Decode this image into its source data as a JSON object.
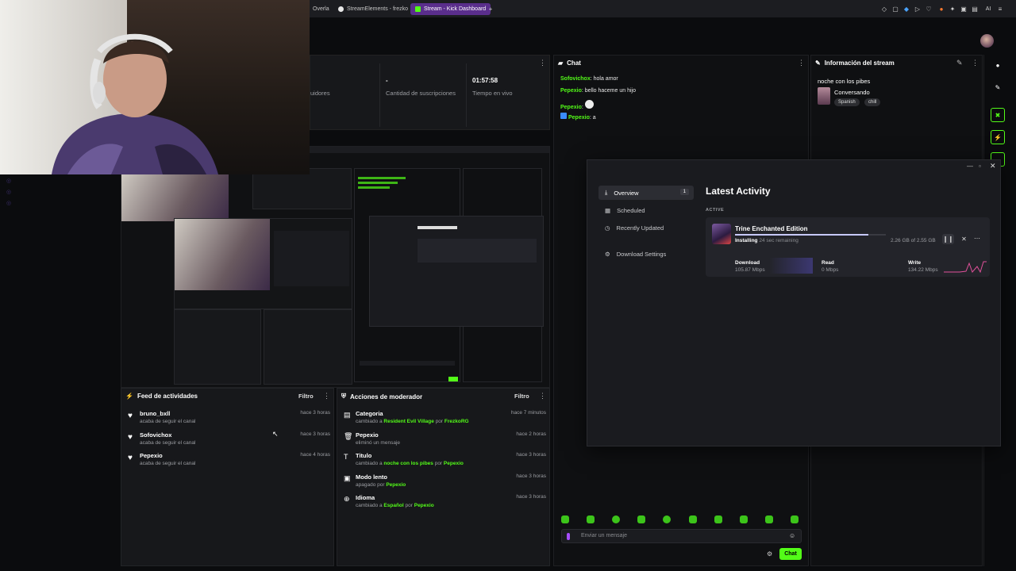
{
  "browser": {
    "tabs": [
      {
        "label": "Overla",
        "active": false
      },
      {
        "label": "StreamElements - frezko",
        "active": false
      },
      {
        "label": "Stream - Kick Dashboard",
        "active": true
      }
    ],
    "new_tab": "+"
  },
  "stats": {
    "items": [
      {
        "value": "",
        "label": "uidores"
      },
      {
        "value": "-",
        "label": "Cantidad de suscripciones"
      },
      {
        "value": "01:57:58",
        "label": "Tiempo en vivo"
      }
    ]
  },
  "chat": {
    "title": "Chat",
    "messages": [
      {
        "user": "Sofovichox",
        "text": " hola amor"
      },
      {
        "user": "Pepexio",
        "text": " bello haceme un hijo"
      },
      {
        "user": "Pepexio",
        "text": ""
      },
      {
        "user": "Pepexio",
        "text": " a"
      }
    ],
    "input_placeholder": "Enviar un mensaje",
    "send_label": "Chat"
  },
  "stream_info": {
    "title": "Información del stream",
    "stream_title": "noche con los pibes",
    "category": "Conversando",
    "tags": [
      "Spanish",
      "chill"
    ]
  },
  "feed": {
    "title": "Feed de actividades",
    "filter": "Filtro",
    "items": [
      {
        "name": "bruno_bxll",
        "sub": "acaba de seguir el canal",
        "time": "hace 3 horas"
      },
      {
        "name": "Sofovichox",
        "sub": "acaba de seguir el canal",
        "time": "hace 3 horas"
      },
      {
        "name": "Pepexio",
        "sub": "acaba de seguir el canal",
        "time": "hace 4 horas"
      }
    ]
  },
  "mod": {
    "title": "Acciones de moderador",
    "filter": "Filtro",
    "items": [
      {
        "name": "Categoria",
        "pre": "cambiado a ",
        "hl1": "Resident Evil Village",
        "mid": " por ",
        "hl2": "FrezkoRG",
        "time": "hace 7 minutos"
      },
      {
        "name": "Pepexio",
        "pre": "eliminó un mensaje",
        "hl1": "",
        "mid": "",
        "hl2": "",
        "time": "hace 2 horas"
      },
      {
        "name": "Titulo",
        "pre": "cambiado a ",
        "hl1": "noche con los pibes",
        "mid": " por ",
        "hl2": "Pepexio",
        "time": "hace 3 horas"
      },
      {
        "name": "Modo lento",
        "pre": "apagado por ",
        "hl1": "Pepexio",
        "mid": "",
        "hl2": "",
        "time": "hace 3 horas"
      },
      {
        "name": "Idioma",
        "pre": "cambiado a ",
        "hl1": "Español",
        "mid": " por ",
        "hl2": "Pepexio",
        "time": "hace 3 horas"
      }
    ]
  },
  "steam": {
    "nav": [
      {
        "label": "Overview",
        "badge": "1"
      },
      {
        "label": "Scheduled",
        "badge": ""
      },
      {
        "label": "Recently Updated",
        "badge": ""
      },
      {
        "label": "Download Settings",
        "badge": ""
      }
    ],
    "heading": "Latest Activity",
    "section": "ACTIVE",
    "game": "Trine Enchanted Edition",
    "status": "Installing",
    "remaining": "24 sec remaining",
    "size": "2.26 GB of 2.55 GB",
    "progress": 0.886,
    "metrics": [
      {
        "label": "Download",
        "value": "105.87 Mbps"
      },
      {
        "label": "Read",
        "value": "0 Mbps"
      },
      {
        "label": "Write",
        "value": "134.22 Mbps"
      }
    ]
  },
  "colors": {
    "accent": "#53fc18",
    "tab_active": "#5a2e8c"
  }
}
